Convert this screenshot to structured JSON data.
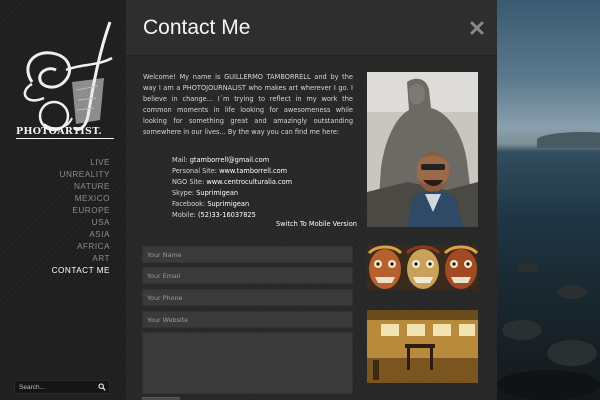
{
  "sidebar": {
    "logo_text": "PHOTOARTIST.",
    "nav": [
      {
        "label": "LIVE",
        "active": false
      },
      {
        "label": "UNREALITY",
        "active": false
      },
      {
        "label": "NATURE",
        "active": false
      },
      {
        "label": "MEXICO",
        "active": false
      },
      {
        "label": "EUROPE",
        "active": false
      },
      {
        "label": "USA",
        "active": false
      },
      {
        "label": "ASIA",
        "active": false
      },
      {
        "label": "AFRICA",
        "active": false
      },
      {
        "label": "ART",
        "active": false
      },
      {
        "label": "CONTACT ME",
        "active": true
      }
    ],
    "search": {
      "placeholder": "Search..."
    }
  },
  "main": {
    "title": "Contact Me",
    "intro": "Welcome! My name is GUILLERMO TAMBORRELL and by the way I am a PHOTOJOURNALIST who makes art wherever I go. I believe in change... I´m trying to reflect in my work the common moments in life looking for awesomeness while looking for something great and amazingly outstanding somewhere in our lives... By the way you can find me here:",
    "contacts": [
      {
        "label": "Mail: ",
        "value": "gtamborrell@gmail.com"
      },
      {
        "label": "Personal Site: ",
        "value": "www.tamborrell.com"
      },
      {
        "label": "NGO Site: ",
        "value": "www.centroculturalia.com"
      },
      {
        "label": "Skype: ",
        "value": "Suprimigean"
      },
      {
        "label": "Facebook: ",
        "value": "Suprimigean"
      },
      {
        "label": "Mobile: ",
        "value": "(52)33-16037825"
      }
    ],
    "mobile_link": "Switch To Mobile Version",
    "form": {
      "name_placeholder": "Your Name",
      "email_placeholder": "Your Email",
      "phone_placeholder": "Your Phone",
      "website_placeholder": "Your Website"
    }
  },
  "icons": {
    "close": "close-icon",
    "search": "search-icon",
    "logo": "logo-monogram-icon"
  },
  "colors": {
    "panel_bg": "#272727",
    "sidebar_bg": "#1e1e1e",
    "nav_inactive": "#8d8d8d",
    "nav_active": "#ffffff"
  }
}
